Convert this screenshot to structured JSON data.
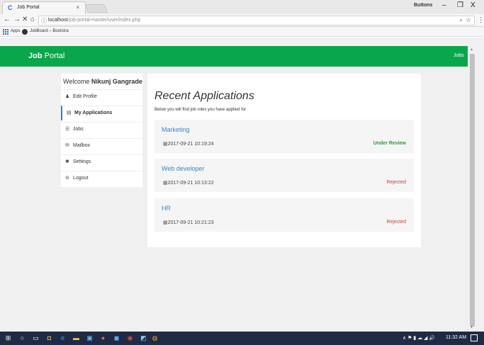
{
  "browser": {
    "tab_title": "Job Portal",
    "tab_close": "×",
    "user_label": "Buttons",
    "window_controls": {
      "minimize": "–",
      "maximize": "❐",
      "close": "X"
    },
    "address": {
      "host": "localhost",
      "path": "/job-portal-master/user/index.php",
      "info_icon": "ⓘ",
      "zoom_icon": "🔍"
    },
    "bookmarks": [
      {
        "label": "Apps"
      },
      {
        "label": "JobBoard – Bootstra"
      }
    ]
  },
  "navbar": {
    "brand_bold": "Job",
    "brand_rest": " Portal",
    "link_jobs": "Jobs",
    "color": "#0aa64b"
  },
  "sidebar": {
    "welcome_prefix": "Welcome ",
    "user_name": "Nikunj Gangrade",
    "items": [
      {
        "label": "Edit Profile",
        "icon": "user-icon",
        "glyph": "♟",
        "active": false
      },
      {
        "label": "My Applications",
        "icon": "list-alt-icon",
        "glyph": "▤",
        "active": true
      },
      {
        "label": "Jobs",
        "icon": "th-list-icon",
        "glyph": "☰",
        "active": false
      },
      {
        "label": "Mailbox",
        "icon": "envelope-icon",
        "glyph": "✉",
        "active": false
      },
      {
        "label": "Settings",
        "icon": "gear-icon",
        "glyph": "✱",
        "active": false
      },
      {
        "label": "Logout",
        "icon": "logout-icon",
        "glyph": "⊖",
        "active": false
      }
    ]
  },
  "main": {
    "title": "Recent Applications",
    "subtitle": "Below you will find job roles you have applied for",
    "applications": [
      {
        "title": "Marketing",
        "date": "2017-09-21 10:19:24",
        "status": "Under Review",
        "status_color": "#2e9a3b"
      },
      {
        "title": "Web developer",
        "date": "2017-09-21 10:13:22",
        "status": "Rejected",
        "status_color": "#d43f3a"
      },
      {
        "title": "HR",
        "date": "2017-09-21 10:21:23",
        "status": "Rejected",
        "status_color": "#d43f3a"
      }
    ]
  },
  "taskbar": {
    "time": "11:32 AM",
    "tray": "∧ ⚑ ▮ ☁ ◢ 🔊"
  }
}
